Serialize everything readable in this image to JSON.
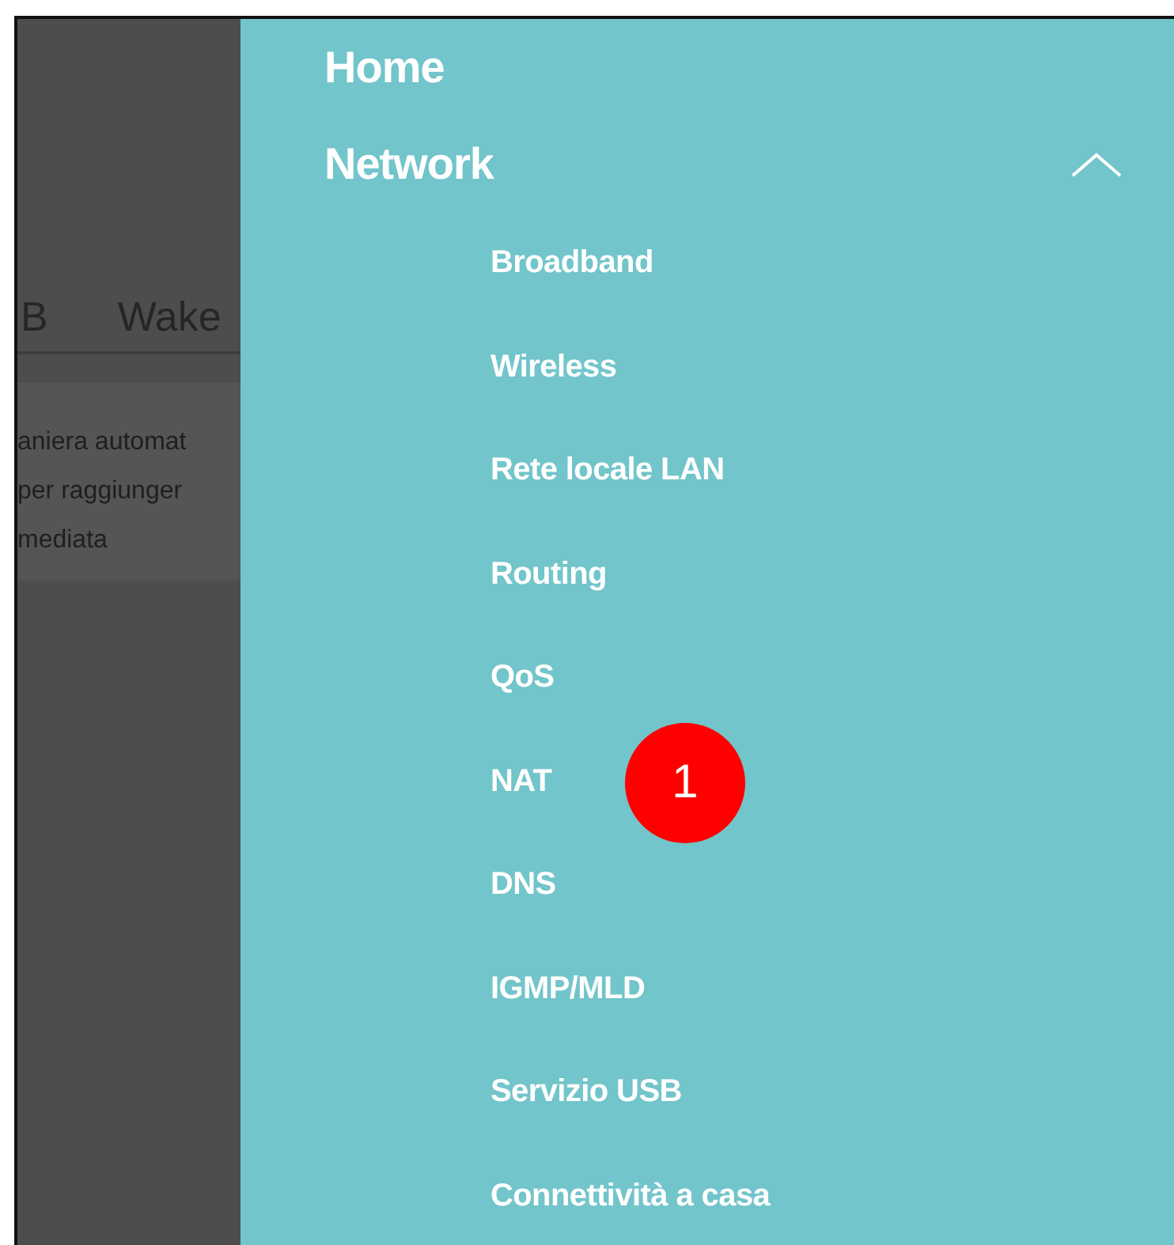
{
  "background_page": {
    "tabs": [
      {
        "label": "B"
      },
      {
        "label": "Wake"
      }
    ],
    "description_lines": [
      "aniera automat",
      " per raggiunger",
      "mediata"
    ]
  },
  "menu": [
    {
      "label": "Home"
    },
    {
      "label": "Network",
      "expanded": true,
      "children": [
        {
          "label": "Broadband"
        },
        {
          "label": "Wireless"
        },
        {
          "label": "Rete locale LAN"
        },
        {
          "label": "Routing"
        },
        {
          "label": "QoS"
        },
        {
          "label": "NAT"
        },
        {
          "label": "DNS"
        },
        {
          "label": "IGMP/MLD"
        },
        {
          "label": "Servizio USB"
        },
        {
          "label": "Connettività a casa"
        }
      ]
    }
  ],
  "callout": {
    "label": "1"
  }
}
